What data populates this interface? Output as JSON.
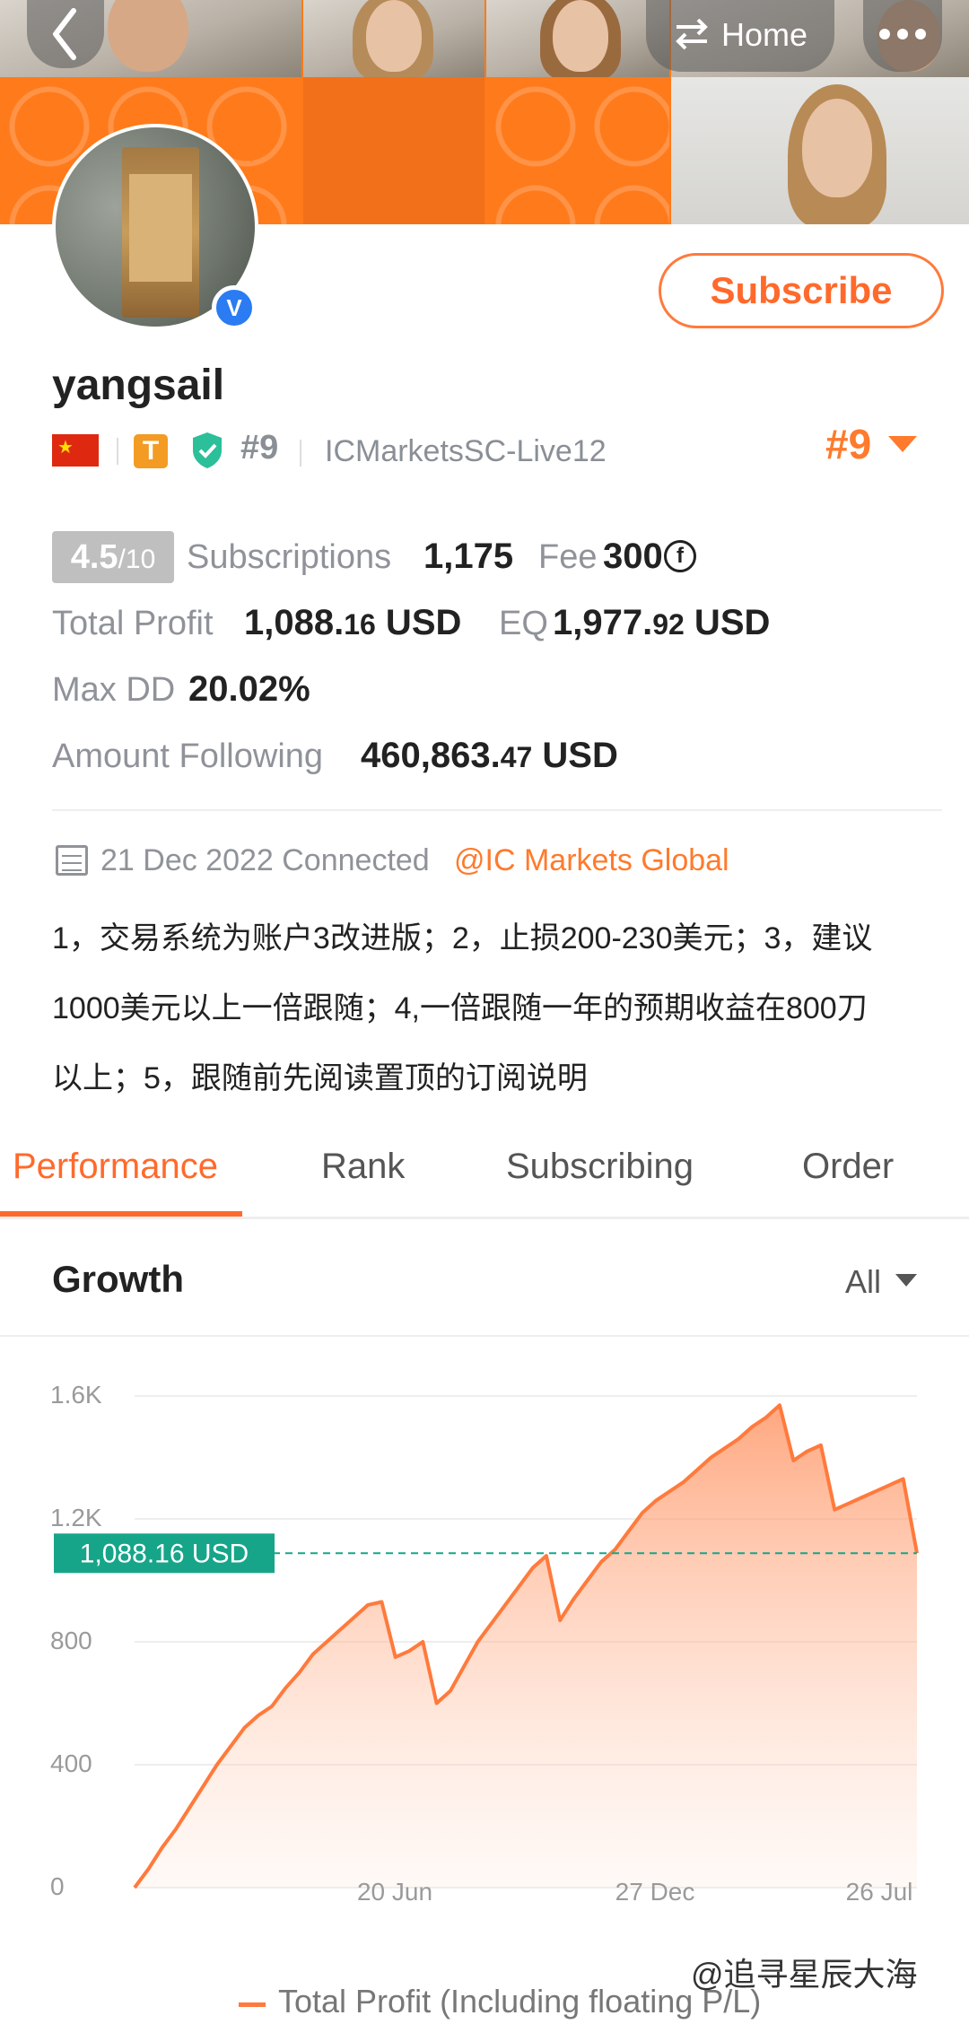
{
  "header": {
    "back_icon": "chevron-left-icon",
    "home_label": "Home",
    "switch_icon": "swap-icon",
    "more_icon": "more-dots-icon"
  },
  "profile": {
    "username": "yangsail",
    "verified_mark": "V",
    "subscribe_label": "Subscribe",
    "flag": "china-flag-icon",
    "badge_t": "T",
    "rank_small": "#9",
    "broker": "ICMarketsSC-Live12",
    "rank_big": "#9"
  },
  "stats": {
    "score": "4.5",
    "score_den": "/10",
    "subscriptions_label": "Subscriptions",
    "subscriptions_value": "1,175",
    "fee_label": "Fee",
    "fee_value": "300",
    "fee_icon_text": "f",
    "total_profit_label": "Total Profit",
    "total_profit_int": "1,088.",
    "total_profit_dec": "16",
    "total_profit_unit": " USD",
    "eq_label": "EQ",
    "eq_int": "1,977.",
    "eq_dec": "92",
    "eq_unit": " USD",
    "maxdd_label": "Max DD",
    "maxdd_value": "20.02%",
    "following_label": "Amount Following",
    "following_int": "460,863.",
    "following_dec": "47",
    "following_unit": " USD"
  },
  "about": {
    "connected": "21 Dec 2022 Connected",
    "broker_link": "@IC Markets Global",
    "line1": "1，交易系统为账户3改进版；2，止损200-230美元；3，建议",
    "line2": "1000美元以上一倍跟随；4,一倍跟随一年的预期收益在800刀",
    "line3": "以上；5，跟随前先阅读置顶的订阅说明"
  },
  "tabs": [
    "Performance",
    "Rank",
    "Subscribing",
    "Order"
  ],
  "growth": {
    "title": "Growth",
    "range": "All"
  },
  "chart_data": {
    "type": "area",
    "ylim": [
      0,
      1600
    ],
    "y_ticks": [
      "0",
      "400",
      "800",
      "1.2K",
      "1.6K"
    ],
    "x_ticks": [
      "20 Jun",
      "27 Dec",
      "26 Jul"
    ],
    "current_value_label": "1,088.16 USD",
    "current_value": 1088.16,
    "line_color": "#ff7a3c",
    "series": [
      {
        "name": "Total Profit (Including floating P/L)",
        "values": [
          0,
          60,
          130,
          190,
          260,
          330,
          400,
          460,
          520,
          560,
          590,
          650,
          700,
          760,
          800,
          840,
          880,
          920,
          930,
          750,
          770,
          800,
          600,
          640,
          720,
          800,
          860,
          920,
          980,
          1040,
          1080,
          870,
          940,
          1000,
          1060,
          1100,
          1160,
          1220,
          1260,
          1290,
          1320,
          1360,
          1400,
          1430,
          1460,
          1500,
          1530,
          1570,
          1390,
          1420,
          1440,
          1230,
          1250,
          1270,
          1290,
          1310,
          1330,
          1088.16
        ]
      }
    ]
  },
  "watermark": "@追寻星辰大海"
}
